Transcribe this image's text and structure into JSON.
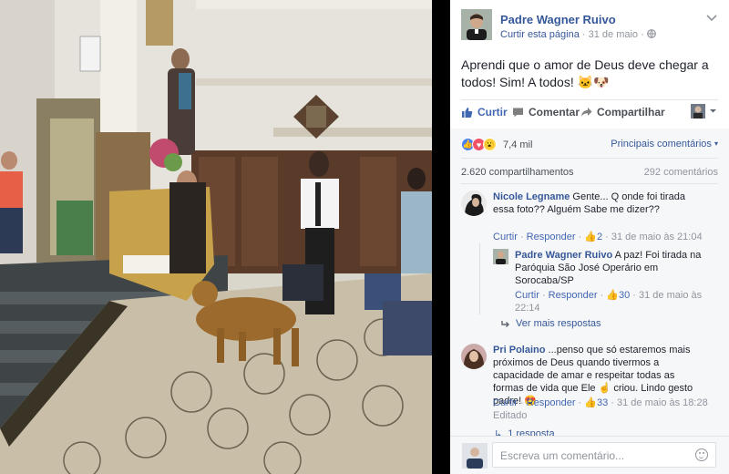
{
  "post": {
    "page_name": "Padre Wagner Ruivo",
    "like_page": "Curtir esta página",
    "date": "31 de maio",
    "text": "Aprendi que o amor de Deus deve chegar a todos! Sim! A todos! 🐱🐶",
    "actions": {
      "like": "Curtir",
      "comment": "Comentar",
      "share": "Compartilhar"
    },
    "reactions_count": "7,4 mil",
    "top_comments": "Principais comentários",
    "shares": "2.620 compartilhamentos",
    "comments": "292 comentários"
  },
  "comments": [
    {
      "author": "Nicole Legname",
      "text": "Gente... Q onde foi tirada essa foto?? Alguém Sabe me dizer??",
      "reply": "Responder",
      "like": "Curtir",
      "likes": "2",
      "time": "31 de maio às 21:04"
    },
    {
      "author": "Padre Wagner Ruivo",
      "text": "A paz! Foi tirada na Paróquia São José Operário em Sorocaba/SP",
      "reply": "Responder",
      "like": "Curtir",
      "likes": "30",
      "time": "31 de maio às 22:14"
    },
    {
      "author": "Pri Polaino",
      "text": "...penso que só estaremos mais próximos de Deus quando tivermos a capacidade de amar e respeitar todas as formas de vida que Ele ☝️ criou. Lindo gesto padre! 😍",
      "reply": "Responder",
      "like": "Curtir",
      "likes": "33",
      "time": "31 de maio às 18:28",
      "edited": "Editado"
    }
  ],
  "more_replies": "Ver mais respostas",
  "one_reply": "1 resposta",
  "comment_placeholder": "Escreva um comentário...",
  "colors": {
    "link": "#365899",
    "action_blue": "#4267b2",
    "muted": "#90949c"
  },
  "icons": [
    "chevron-down-icon",
    "globe-icon",
    "thumbs-up-icon",
    "comment-icon",
    "share-arrow-icon",
    "smiley-icon",
    "reply-arrow-icon"
  ]
}
